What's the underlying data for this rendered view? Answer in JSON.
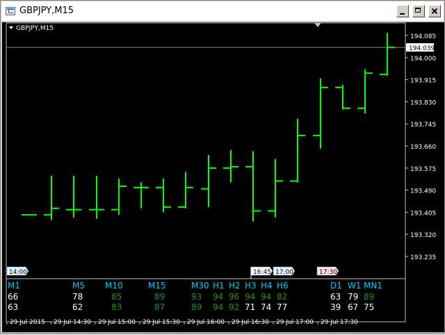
{
  "window": {
    "title": "GBPJPY,M15"
  },
  "chart": {
    "symbol_label": "GBPJPY,M15",
    "price_axis": [
      "194.085",
      "194.000",
      "193.915",
      "193.830",
      "193.745",
      "193.660",
      "193.575",
      "193.490",
      "193.405",
      "193.320",
      "193.235"
    ],
    "current_price": "194.039",
    "bar_color": "#00ff00",
    "time_axis": [
      "29 Jul 2015",
      "29 Jul 14:30",
      "29 Jul 15:00",
      "29 Jul 15:30",
      "29 Jul 16:00",
      "29 Jul 16:30",
      "29 Jul 17:00",
      "29 Jul 17:30"
    ],
    "period_markers": [
      {
        "label": "14:00",
        "color": "#e0f4ff"
      },
      {
        "label": "16:45",
        "color": "#ffffff"
      },
      {
        "label": "17:00",
        "color": "#e0f4ff"
      },
      {
        "label": "17:30",
        "color": "#ffe0e6"
      }
    ],
    "bars": [
      {
        "o": 193.395,
        "h": 193.395,
        "l": 193.395,
        "c": 193.395
      },
      {
        "o": 193.395,
        "h": 193.545,
        "l": 193.375,
        "c": 193.42
      },
      {
        "o": 193.415,
        "h": 193.545,
        "l": 193.385,
        "c": 193.415
      },
      {
        "o": 193.415,
        "h": 193.545,
        "l": 193.38,
        "c": 193.415
      },
      {
        "o": 193.415,
        "h": 193.535,
        "l": 193.395,
        "c": 193.505
      },
      {
        "o": 193.5,
        "h": 193.52,
        "l": 193.42,
        "c": 193.5
      },
      {
        "o": 193.5,
        "h": 193.535,
        "l": 193.405,
        "c": 193.425
      },
      {
        "o": 193.425,
        "h": 193.56,
        "l": 193.42,
        "c": 193.5
      },
      {
        "o": 193.495,
        "h": 193.625,
        "l": 193.425,
        "c": 193.575
      },
      {
        "o": 193.575,
        "h": 193.645,
        "l": 193.52,
        "c": 193.58
      },
      {
        "o": 193.58,
        "h": 193.64,
        "l": 193.37,
        "c": 193.41
      },
      {
        "o": 193.41,
        "h": 193.61,
        "l": 193.385,
        "c": 193.525
      },
      {
        "o": 193.525,
        "h": 193.765,
        "l": 193.52,
        "c": 193.7
      },
      {
        "o": 193.7,
        "h": 193.92,
        "l": 193.65,
        "c": 193.885
      },
      {
        "o": 193.885,
        "h": 193.895,
        "l": 193.8,
        "c": 193.805
      },
      {
        "o": 193.805,
        "h": 193.955,
        "l": 193.785,
        "c": 193.94
      },
      {
        "o": 193.935,
        "h": 194.095,
        "l": 193.93,
        "c": 194.039
      }
    ]
  },
  "indicator": {
    "timeframes": [
      {
        "tf": "M1",
        "a": "66",
        "b": "63",
        "color_a": "#ffffff",
        "color_b": "#ffffff"
      },
      {
        "tf": "M5",
        "a": "78",
        "b": "62",
        "color_a": "#ffffff",
        "color_b": "#ffffff"
      },
      {
        "tf": "M10",
        "a": "85",
        "b": "83",
        "color_a": "#2e8b2e",
        "color_b": "#2e8b2e"
      },
      {
        "tf": "M15",
        "a": "89",
        "b": "87",
        "color_a": "#2e8b2e",
        "color_b": "#2e8b2e"
      },
      {
        "tf": "M30",
        "a": "93",
        "b": "89",
        "color_a": "#2e8b2e",
        "color_b": "#2e8b2e"
      },
      {
        "tf": "H1",
        "a": "94",
        "b": "94",
        "color_a": "#2e8b2e",
        "color_b": "#2e8b2e"
      },
      {
        "tf": "H2",
        "a": "96",
        "b": "92",
        "color_a": "#2e8b2e",
        "color_b": "#2e8b2e"
      },
      {
        "tf": "H3",
        "a": "94",
        "b": "71",
        "color_a": "#2e8b2e",
        "color_b": "#ffffff"
      },
      {
        "tf": "H4",
        "a": "94",
        "b": "74",
        "color_a": "#2e8b2e",
        "color_b": "#ffffff"
      },
      {
        "tf": "H6",
        "a": "82",
        "b": "77",
        "color_a": "#2e8b2e",
        "color_b": "#ffffff"
      },
      {
        "tf": "D1",
        "a": "63",
        "b": "39",
        "color_a": "#ffffff",
        "color_b": "#ffffff"
      },
      {
        "tf": "W1",
        "a": "79",
        "b": "67",
        "color_a": "#ffffff",
        "color_b": "#ffffff"
      },
      {
        "tf": "MN1",
        "a": "89",
        "b": "75",
        "color_a": "#2e8b2e",
        "color_b": "#ffffff"
      }
    ]
  }
}
